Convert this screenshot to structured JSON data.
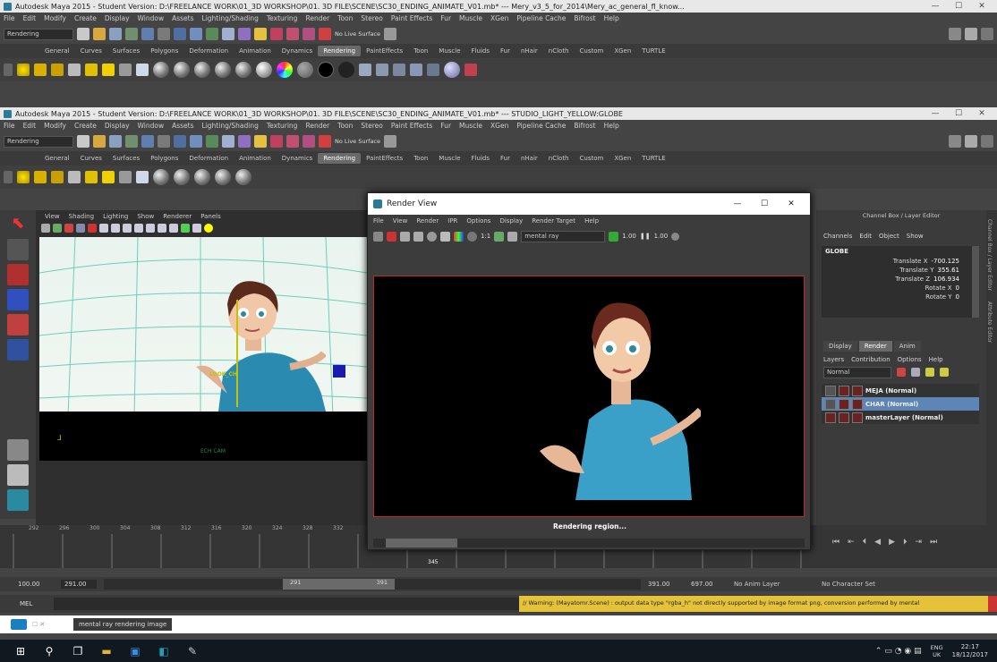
{
  "back_window": {
    "title": "Autodesk Maya 2015 - Student Version: D:\\FREELANCE WORK\\01_3D WORKSHOP\\01. 3D FILE\\SCENE\\SC30_ENDING_ANIMATE_V01.mb* --- Mery_v3_5_for_2014\\Mery_ac_general_fl_know...",
    "menus": [
      "File",
      "Edit",
      "Modify",
      "Create",
      "Display",
      "Window",
      "Assets",
      "Lighting/Shading",
      "Texturing",
      "Render",
      "Toon",
      "Stereo",
      "Paint Effects",
      "Fur",
      "Muscle",
      "XGen",
      "Pipeline Cache",
      "Bifrost",
      "Help"
    ],
    "mode": "Rendering",
    "shelf_tabs": [
      "General",
      "Curves",
      "Surfaces",
      "Polygons",
      "Deformation",
      "Animation",
      "Dynamics",
      "Rendering",
      "PaintEffects",
      "Toon",
      "Muscle",
      "Fluids",
      "Fur",
      "nHair",
      "nCloth",
      "Custom",
      "XGen",
      "TURTLE"
    ],
    "active_shelf": "Rendering",
    "live_surface": "No Live Surface"
  },
  "main_window": {
    "title": "Autodesk Maya 2015 - Student Version: D:\\FREELANCE WORK\\01_3D WORKSHOP\\01. 3D FILE\\SCENE\\SC30_ENDING_ANIMATE_V01.mb* --- STUDIO_LIGHT_YELLOW:GLOBE",
    "menus": [
      "File",
      "Edit",
      "Modify",
      "Create",
      "Display",
      "Window",
      "Assets",
      "Lighting/Shading",
      "Texturing",
      "Render",
      "Toon",
      "Stereo",
      "Paint Effects",
      "Fur",
      "Muscle",
      "XGen",
      "Pipeline Cache",
      "Bifrost",
      "Help"
    ],
    "mode": "Rendering",
    "shelf_tabs": [
      "General",
      "Curves",
      "Surfaces",
      "Polygons",
      "Deformation",
      "Animation",
      "Dynamics",
      "Rendering",
      "PaintEffects",
      "Toon",
      "Muscle",
      "Fluids",
      "Fur",
      "nHair",
      "nCloth",
      "Custom",
      "XGen",
      "TURTLE"
    ],
    "active_shelf": "Rendering",
    "live_surface": "No Live Surface"
  },
  "viewport": {
    "menus": [
      "View",
      "Shading",
      "Lighting",
      "Show",
      "Renderer",
      "Panels"
    ],
    "camera_label": "ECH CAM",
    "handle_label": "LOOK_CH"
  },
  "render_view": {
    "title": "Render View",
    "menus": [
      "File",
      "View",
      "Render",
      "IPR",
      "Options",
      "Display",
      "Render Target",
      "Help"
    ],
    "ratio": "1:1",
    "renderer": "mental ray",
    "exposure": "1.00",
    "gamma": "1.00",
    "status": "Rendering region..."
  },
  "channel_box": {
    "header": "Channel Box / Layer Editor",
    "menus": [
      "Channels",
      "Edit",
      "Object",
      "Show"
    ],
    "object": "GLOBE",
    "channels": [
      {
        "label": "Translate X",
        "value": "-700.125"
      },
      {
        "label": "Translate Y",
        "value": "355.61"
      },
      {
        "label": "Translate Z",
        "value": "106.934"
      },
      {
        "label": "Rotate X",
        "value": "0"
      },
      {
        "label": "Rotate Y",
        "value": "0"
      }
    ],
    "side_tabs": [
      "Channel Box / Layer Editor",
      "Attribute Editor"
    ]
  },
  "layer_editor": {
    "tabs": [
      "Display",
      "Render",
      "Anim"
    ],
    "active_tab": "Render",
    "menus": [
      "Layers",
      "Contribution",
      "Options",
      "Help"
    ],
    "blend_mode": "Normal",
    "layers": [
      {
        "name": "MEJA (Normal)",
        "selected": false
      },
      {
        "name": "CHAR (Normal)",
        "selected": true
      },
      {
        "name": "masterLayer (Normal)",
        "selected": false
      }
    ]
  },
  "timeline": {
    "ticks": [
      "292",
      "296",
      "300",
      "304",
      "308",
      "312",
      "316",
      "320",
      "324",
      "328",
      "332"
    ],
    "current_frame": "345"
  },
  "range": {
    "start": "100.00",
    "inner_start": "291.00",
    "slider_start": "291",
    "slider_end": "391",
    "inner_end": "391.00",
    "end": "697.00",
    "anim_layer": "No Anim Layer",
    "character_set": "No Character Set"
  },
  "command": {
    "lang": "MEL",
    "warning": "// Warning: (Mayatomr.Scene) : output data type \"rgba_h\" not directly supported by image format png, conversion performed by mental"
  },
  "help_line": "mental ray rendering image",
  "taskbar": {
    "lang": "ENG",
    "region": "UK",
    "time": "22:17",
    "date": "18/12/2017"
  }
}
